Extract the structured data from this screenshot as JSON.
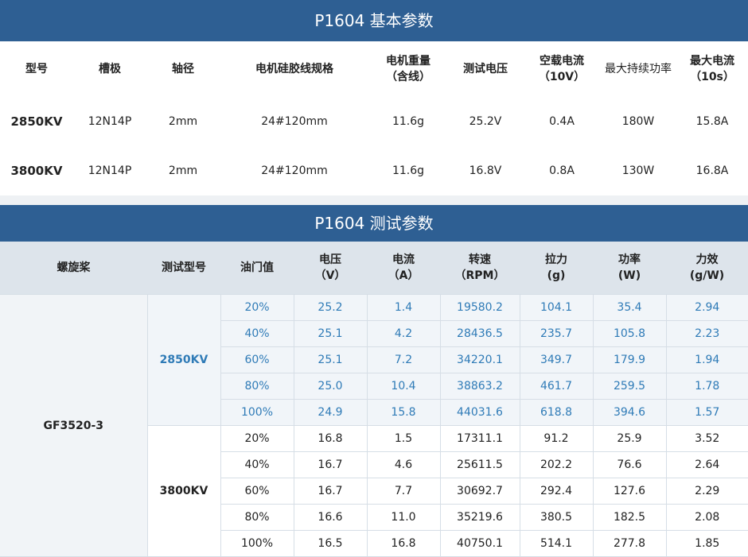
{
  "basic": {
    "title": "P1604 基本参数",
    "headers": [
      [
        "型号"
      ],
      [
        "槽极"
      ],
      [
        "轴径"
      ],
      [
        "电机硅胶线规格"
      ],
      [
        "电机重量",
        "（含线）"
      ],
      [
        "测试电压"
      ],
      [
        "空载电流",
        "（10V）"
      ],
      [
        "最大持续功率"
      ],
      [
        "最大电流",
        "（10s）"
      ]
    ],
    "rows": [
      [
        "2850KV",
        "12N14P",
        "2mm",
        "24#120mm",
        "11.6g",
        "25.2V",
        "0.4A",
        "180W",
        "15.8A"
      ],
      [
        "3800KV",
        "12N14P",
        "2mm",
        "24#120mm",
        "11.6g",
        "16.8V",
        "0.8A",
        "130W",
        "16.8A"
      ]
    ]
  },
  "test": {
    "title": "P1604 测试参数",
    "headers": [
      [
        "螺旋桨"
      ],
      [
        "测试型号"
      ],
      [
        "油门值"
      ],
      [
        "电压",
        "（V）"
      ],
      [
        "电流",
        "（A）"
      ],
      [
        "转速",
        "（RPM）"
      ],
      [
        "拉力",
        "(g)"
      ],
      [
        "功率",
        "(W)"
      ],
      [
        "力效",
        "(g/W)"
      ]
    ],
    "propeller": "GF3520-3",
    "groups": [
      {
        "model": "2850KV",
        "rows": [
          [
            "20%",
            "25.2",
            "1.4",
            "19580.2",
            "104.1",
            "35.4",
            "2.94"
          ],
          [
            "40%",
            "25.1",
            "4.2",
            "28436.5",
            "235.7",
            "105.8",
            "2.23"
          ],
          [
            "60%",
            "25.1",
            "7.2",
            "34220.1",
            "349.7",
            "179.9",
            "1.94"
          ],
          [
            "80%",
            "25.0",
            "10.4",
            "38863.2",
            "461.7",
            "259.5",
            "1.78"
          ],
          [
            "100%",
            "24.9",
            "15.8",
            "44031.6",
            "618.8",
            "394.6",
            "1.57"
          ]
        ]
      },
      {
        "model": "3800KV",
        "rows": [
          [
            "20%",
            "16.8",
            "1.5",
            "17311.1",
            "91.2",
            "25.9",
            "3.52"
          ],
          [
            "40%",
            "16.7",
            "4.6",
            "25611.5",
            "202.2",
            "76.6",
            "2.64"
          ],
          [
            "60%",
            "16.7",
            "7.7",
            "30692.7",
            "292.4",
            "127.6",
            "2.29"
          ],
          [
            "80%",
            "16.6",
            "11.0",
            "35219.6",
            "380.5",
            "182.5",
            "2.08"
          ],
          [
            "100%",
            "16.5",
            "16.8",
            "40750.1",
            "514.1",
            "277.8",
            "1.85"
          ]
        ]
      }
    ]
  }
}
